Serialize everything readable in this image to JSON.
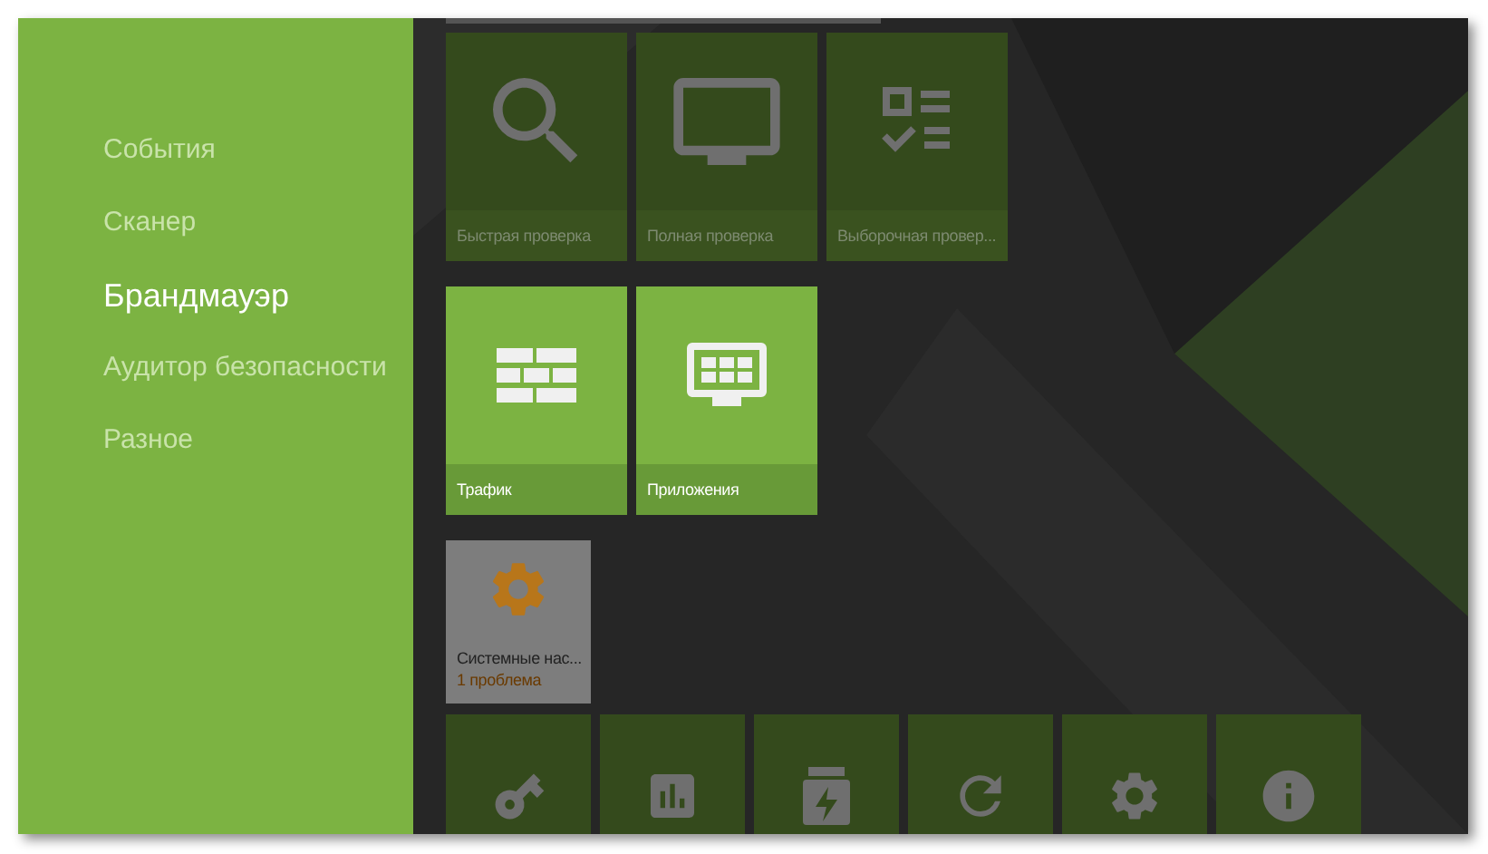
{
  "sidebar": {
    "items": [
      {
        "label": "События",
        "selected": false
      },
      {
        "label": "Сканер",
        "selected": false
      },
      {
        "label": "Брандмауэр",
        "selected": true
      },
      {
        "label": "Аудитор безопасности",
        "selected": false
      },
      {
        "label": "Разное",
        "selected": false
      }
    ]
  },
  "tile_rows": [
    {
      "tiles": [
        {
          "kind": "dim",
          "label": "Быстрая проверка"
        },
        {
          "kind": "dim",
          "label": "Полная проверка"
        },
        {
          "kind": "dim",
          "label": "Выборочная провер..."
        }
      ]
    },
    {
      "tiles": [
        {
          "kind": "active",
          "label": "Трафик"
        },
        {
          "kind": "active",
          "label": "Приложения"
        }
      ]
    },
    {
      "tiles": [
        {
          "kind": "alert",
          "label": "Системные нас...",
          "note": "1 проблема"
        }
      ]
    },
    {
      "tiles": [
        {
          "kind": "dim"
        },
        {
          "kind": "dim"
        },
        {
          "kind": "dim"
        },
        {
          "kind": "dim"
        },
        {
          "kind": "dim"
        },
        {
          "kind": "dim"
        }
      ]
    }
  ]
}
